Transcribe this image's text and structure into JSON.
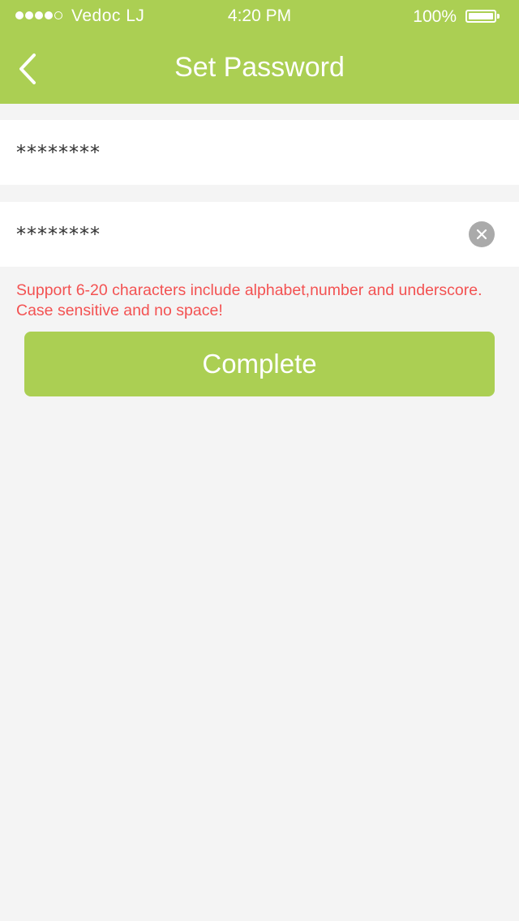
{
  "status_bar": {
    "carrier": "Vedoc LJ",
    "time": "4:20 PM",
    "battery": "100%",
    "signal_strength": 4,
    "signal_max": 5
  },
  "nav": {
    "title": "Set Password",
    "back_icon": "chevron-left-icon"
  },
  "form": {
    "password_value": "********",
    "confirm_value": "********",
    "clear_icon": "clear-circle-icon"
  },
  "hint": {
    "line1": "Support 6-20 characters include alphabet,number and underscore.",
    "line2": "Case sensitive and no space!"
  },
  "complete_label": "Complete",
  "colors": {
    "accent": "#abcf53",
    "background": "#f4f4f4",
    "error": "#f35252",
    "clear_icon": "#aaaaaa"
  }
}
